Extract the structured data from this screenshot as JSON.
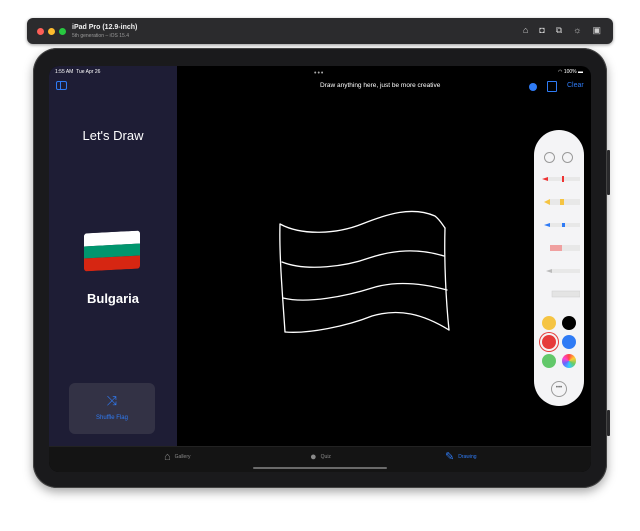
{
  "simulator": {
    "device_name": "iPad Pro (12.9-inch)",
    "subtitle": "5th generation – iOS 15.4",
    "toolbar_icons": [
      "home-icon",
      "screenshot-icon",
      "rotate-icon",
      "appearance-icon",
      "menu-icon"
    ]
  },
  "status_bar": {
    "time": "1:55 AM",
    "date": "Tue Apr 26",
    "battery": "100%"
  },
  "sidebar": {
    "heading": "Let's Draw",
    "country": "Bulgaria",
    "flag_colors": [
      "#ffffff",
      "#00966e",
      "#d62612"
    ],
    "shuffle_label": "Shuffle Flag"
  },
  "canvas": {
    "prompt": "Draw anything here, just be more creative",
    "clear_label": "Clear"
  },
  "palette": {
    "tools": [
      "pen",
      "marker",
      "pencil",
      "eraser",
      "lasso",
      "ruler"
    ],
    "colors": [
      "#f5c443",
      "#000000",
      "#e63b3b",
      "#2f7bf5",
      "#62c86a",
      "color-wheel"
    ]
  },
  "tabs": [
    {
      "label": "Gallery",
      "icon": "house-icon"
    },
    {
      "label": "Quiz",
      "icon": "lightbulb-icon"
    },
    {
      "label": "Drawing",
      "icon": "pencil-scribble-icon"
    }
  ],
  "accent_color": "#2f7bf5"
}
